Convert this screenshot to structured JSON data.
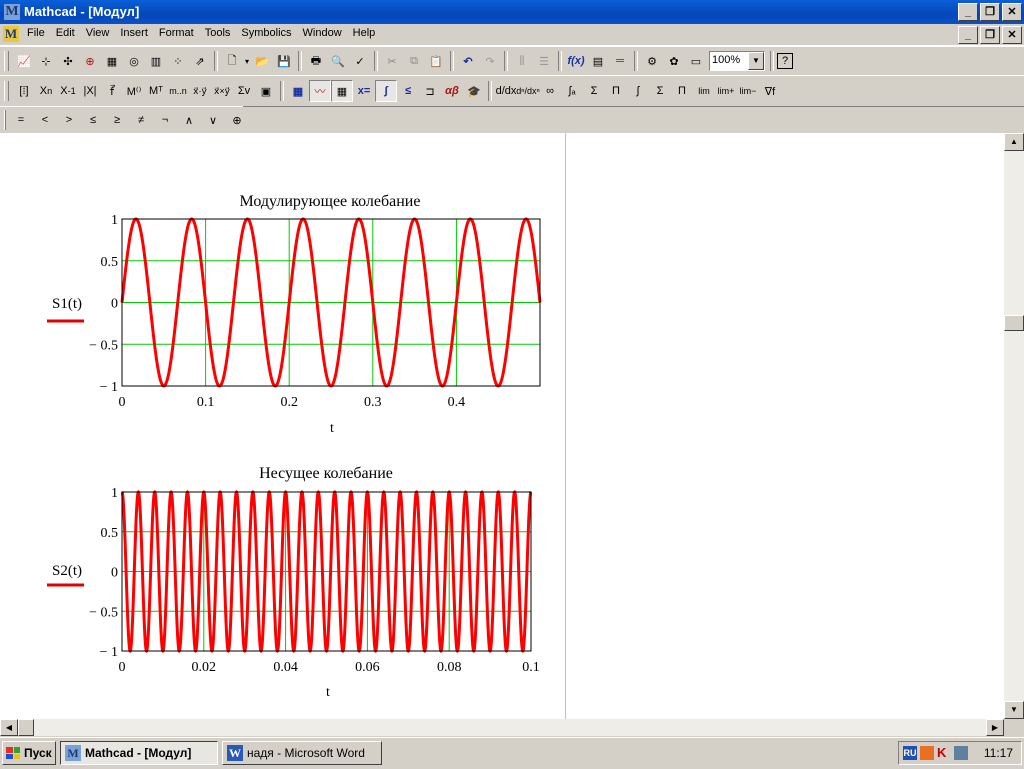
{
  "window": {
    "title": "Mathcad - [Модул]",
    "app_icon": "mathcad-icon"
  },
  "menu": [
    "File",
    "Edit",
    "View",
    "Insert",
    "Format",
    "Tools",
    "Symbolics",
    "Window",
    "Help"
  ],
  "toolbar": {
    "zoom": "100%"
  },
  "toolbar_math_ops": [
    "=",
    "<",
    ">",
    "≤",
    "≥",
    "≠",
    "¬",
    "∧",
    "∨",
    "⊕"
  ],
  "plots": [
    {
      "title": "Модулирующее колебание",
      "ylabel": "S1(t)",
      "xlabel": "t",
      "xticks": [
        "0",
        "0.1",
        "0.2",
        "0.3",
        "0.4"
      ],
      "yticks": [
        "1",
        "0.5",
        "0",
        "− 0.5",
        "− 1"
      ]
    },
    {
      "title": "Несущее колебание",
      "ylabel": "S2(t)",
      "xlabel": "t",
      "xticks": [
        "0",
        "0.02",
        "0.04",
        "0.06",
        "0.08",
        "0.1"
      ],
      "yticks": [
        "1",
        "0.5",
        "0",
        "− 0.5",
        "− 1"
      ]
    }
  ],
  "chart_data": [
    {
      "type": "line",
      "title": "Модулирующее колебание",
      "xlabel": "t",
      "ylabel": "S1(t)",
      "xlim": [
        0,
        0.5
      ],
      "ylim": [
        -1,
        1
      ],
      "grid": true,
      "series": [
        {
          "name": "S1(t)",
          "function": "sin(2π·15·t)",
          "frequency": 15,
          "amplitude": 1,
          "color": "#ff0000"
        }
      ]
    },
    {
      "type": "line",
      "title": "Несущее колебание",
      "xlabel": "t",
      "ylabel": "S2(t)",
      "xlim": [
        0,
        0.1
      ],
      "ylim": [
        -1,
        1
      ],
      "grid": true,
      "series": [
        {
          "name": "S2(t)",
          "function": "cos(2π·250·t)",
          "frequency": 250,
          "amplitude": 1,
          "color": "#ff0000"
        }
      ]
    }
  ],
  "taskbar": {
    "start": "Пуск",
    "tasks": [
      {
        "label": "Mathcad - [Модул]",
        "active": true
      },
      {
        "label": "надя - Microsoft Word",
        "active": false
      }
    ],
    "lang": "RU",
    "clock": "11:17"
  }
}
